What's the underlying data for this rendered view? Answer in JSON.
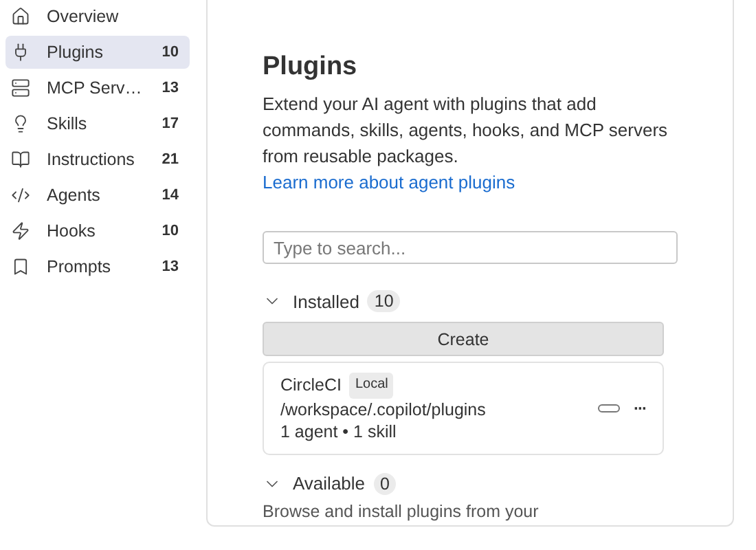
{
  "sidebar": {
    "items": [
      {
        "label": "Overview",
        "selected": false
      },
      {
        "label": "Plugins",
        "count": "10",
        "selected": true
      },
      {
        "label": "MCP Serv…",
        "count": "13",
        "selected": false
      },
      {
        "label": "Skills",
        "count": "17",
        "selected": false
      },
      {
        "label": "Instructions",
        "count": "21",
        "selected": false
      },
      {
        "label": "Agents",
        "count": "14",
        "selected": false
      },
      {
        "label": "Hooks",
        "count": "10",
        "selected": false
      },
      {
        "label": "Prompts",
        "count": "13",
        "selected": false
      }
    ]
  },
  "page": {
    "title": "Plugins",
    "description": "Extend your AI agent with plugins that add commands, skills, agents, hooks, and MCP servers from reusable packages.",
    "link": "Learn more about agent plugins",
    "search": {
      "placeholder": "Type to search..."
    },
    "sections": [
      {
        "title": "Installed",
        "count": "10",
        "expanded": true,
        "button": "Create",
        "plugins": [
          {
            "name": "CircleCI",
            "badge": "Local",
            "path": "/workspace/.copilot/plugins",
            "summary": "1 agent • 1 skill",
            "more": "···"
          }
        ]
      },
      {
        "title": "Available",
        "count": "0",
        "expanded": true,
        "text": "Browse and install plugins from your"
      }
    ]
  }
}
